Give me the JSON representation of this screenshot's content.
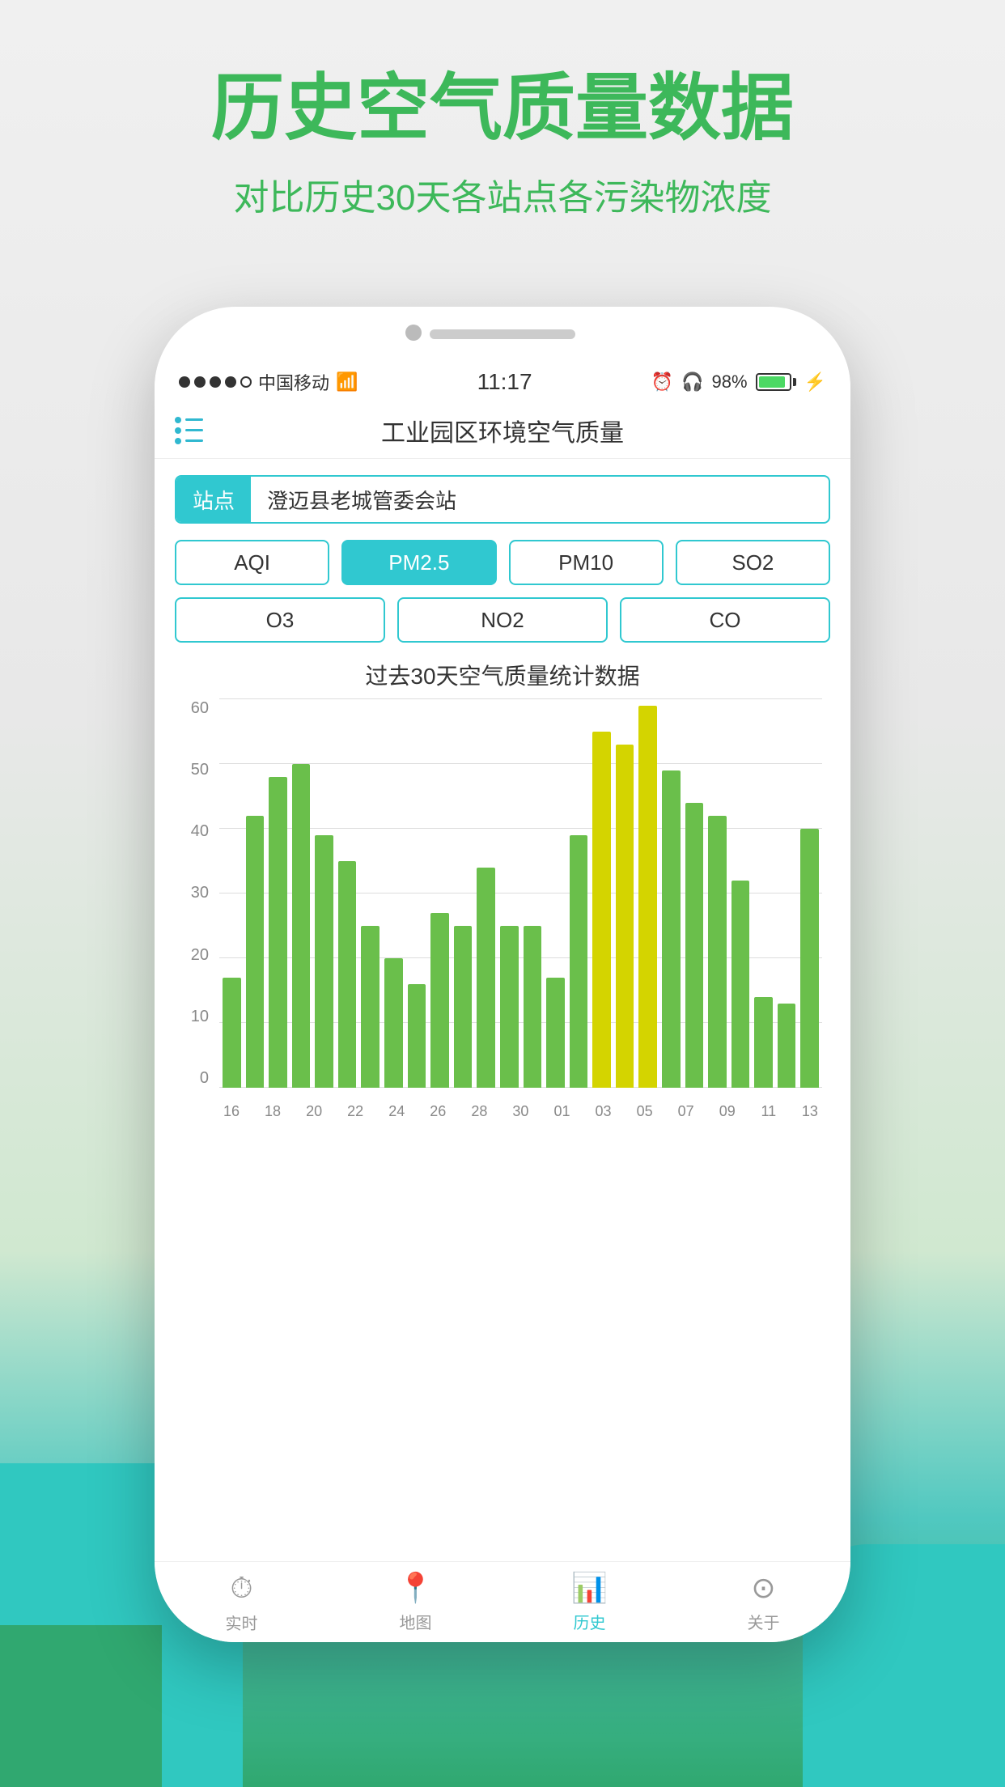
{
  "background": {
    "title_main": "历史空气质量数据",
    "title_sub": "对比历史30天各站点各污染物浓度"
  },
  "status_bar": {
    "carrier": "中国移动",
    "time": "11:17",
    "battery": "98%"
  },
  "header": {
    "title": "工业园区环境空气质量"
  },
  "station": {
    "label": "站点",
    "value": "澄迈县老城管委会站"
  },
  "pollutants": {
    "row1": [
      "AQI",
      "PM2.5",
      "PM10",
      "SO2"
    ],
    "row2": [
      "O3",
      "NO2",
      "CO"
    ],
    "active": "PM2.5"
  },
  "chart": {
    "title": "过去30天空气质量统计数据",
    "y_labels": [
      "0",
      "10",
      "20",
      "30",
      "40",
      "50",
      "60"
    ],
    "x_labels": [
      "16",
      "18",
      "20",
      "22",
      "24",
      "26",
      "28",
      "30",
      "01",
      "03",
      "05",
      "07",
      "09",
      "11",
      "13"
    ],
    "bars": [
      {
        "value": 17,
        "color": "green"
      },
      {
        "value": 42,
        "color": "green"
      },
      {
        "value": 48,
        "color": "green"
      },
      {
        "value": 50,
        "color": "green"
      },
      {
        "value": 39,
        "color": "green"
      },
      {
        "value": 35,
        "color": "green"
      },
      {
        "value": 25,
        "color": "green"
      },
      {
        "value": 20,
        "color": "green"
      },
      {
        "value": 16,
        "color": "green"
      },
      {
        "value": 27,
        "color": "green"
      },
      {
        "value": 25,
        "color": "green"
      },
      {
        "value": 34,
        "color": "green"
      },
      {
        "value": 25,
        "color": "green"
      },
      {
        "value": 25,
        "color": "green"
      },
      {
        "value": 17,
        "color": "green"
      },
      {
        "value": 39,
        "color": "green"
      },
      {
        "value": 55,
        "color": "yellow"
      },
      {
        "value": 53,
        "color": "yellow"
      },
      {
        "value": 59,
        "color": "yellow"
      },
      {
        "value": 49,
        "color": "green"
      },
      {
        "value": 44,
        "color": "green"
      },
      {
        "value": 42,
        "color": "green"
      },
      {
        "value": 32,
        "color": "green"
      },
      {
        "value": 14,
        "color": "green"
      },
      {
        "value": 13,
        "color": "green"
      },
      {
        "value": 40,
        "color": "green"
      }
    ],
    "max_value": 60
  },
  "bottom_nav": {
    "items": [
      {
        "label": "实时",
        "icon": "clock",
        "active": false
      },
      {
        "label": "地图",
        "icon": "map-pin",
        "active": false
      },
      {
        "label": "历史",
        "icon": "bar-chart",
        "active": true
      },
      {
        "label": "关于",
        "icon": "more-circle",
        "active": false
      }
    ]
  }
}
